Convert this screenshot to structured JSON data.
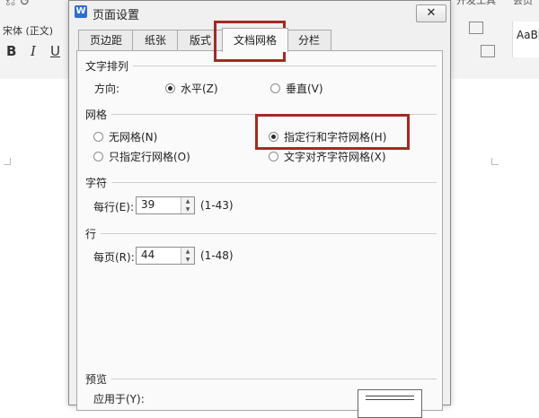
{
  "background": {
    "font_name": "宋体 (正文)",
    "bold_label": "B",
    "italic_label": "I",
    "underline_label": "U",
    "devtools_label": "开发工具",
    "extra_label": "会员",
    "style_preview": "AaBb"
  },
  "dialog": {
    "icon_label": "W",
    "title": "页面设置",
    "close_label": "✕",
    "tabs": [
      "页边距",
      "纸张",
      "版式",
      "文档网格",
      "分栏"
    ],
    "active_tab": "文档网格",
    "text_direction": {
      "section_label": "文字排列",
      "direction_label": "方向:",
      "horizontal": "水平(Z)",
      "vertical": "垂直(V)",
      "selected": "horizontal"
    },
    "grid": {
      "section_label": "网格",
      "options": {
        "no_grid": "无网格(N)",
        "line_and_char_grid": "指定行和字符网格(H)",
        "line_grid_only": "只指定行网格(O)",
        "snap_to_char_grid": "文字对齐字符网格(X)"
      },
      "selected": "line_and_char_grid"
    },
    "characters": {
      "section_label": "字符",
      "per_line_label": "每行(E):",
      "per_line_value": "39",
      "range": "(1-43)"
    },
    "lines": {
      "section_label": "行",
      "per_page_label": "每页(R):",
      "per_page_value": "44",
      "range": "(1-48)"
    },
    "preview": {
      "section_label": "预览",
      "apply_to_label": "应用于(Y):"
    }
  },
  "colors": {
    "highlight": "#a32a23",
    "dialog_bg": "#f0f0f0",
    "panel_bg": "#fafafa"
  }
}
